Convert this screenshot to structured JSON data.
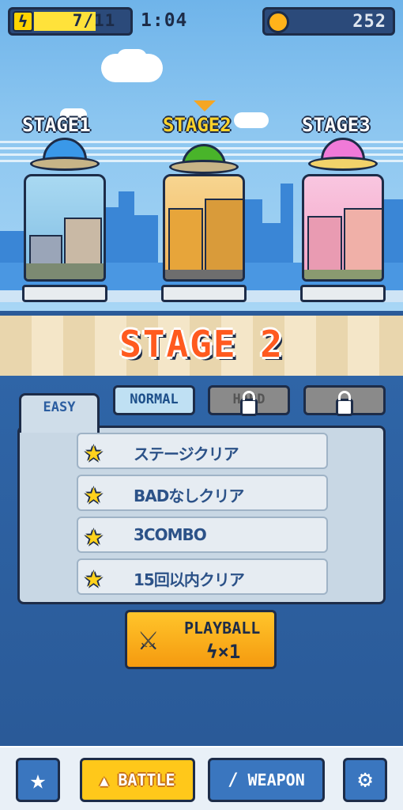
{
  "status": {
    "energy_text": "7/11",
    "energy_ratio": 0.64,
    "timer": "1:04",
    "coins": "252"
  },
  "stages": [
    {
      "label": "STAGE1",
      "ufo_color": "#3a98e8",
      "jar_color": "#9fd0ea",
      "selected": false
    },
    {
      "label": "STAGE2",
      "ufo_color": "#49b42a",
      "jar_color": "#f5b84a",
      "selected": true
    },
    {
      "label": "STAGE3",
      "ufo_color": "#f07ad8",
      "jar_color": "#f5b0c8",
      "selected": false
    }
  ],
  "stage_title": "STAGE 2",
  "tabs": {
    "easy": "EASY",
    "normal": "NORMAL",
    "hard": "HARD"
  },
  "missions": [
    {
      "label": "ステージクリア"
    },
    {
      "label": "BADなしクリア"
    },
    {
      "label": "3COMBO"
    },
    {
      "label": "15回以内クリア"
    }
  ],
  "play": {
    "label": "PLAYBALL",
    "cost": "×1"
  },
  "nav": {
    "battle": "BATTLE",
    "weapon": "WEAPON"
  },
  "colors": {
    "accent_orange": "#ff5a1f",
    "button_yellow": "#ffc52b",
    "outline": "#1d2c48"
  }
}
